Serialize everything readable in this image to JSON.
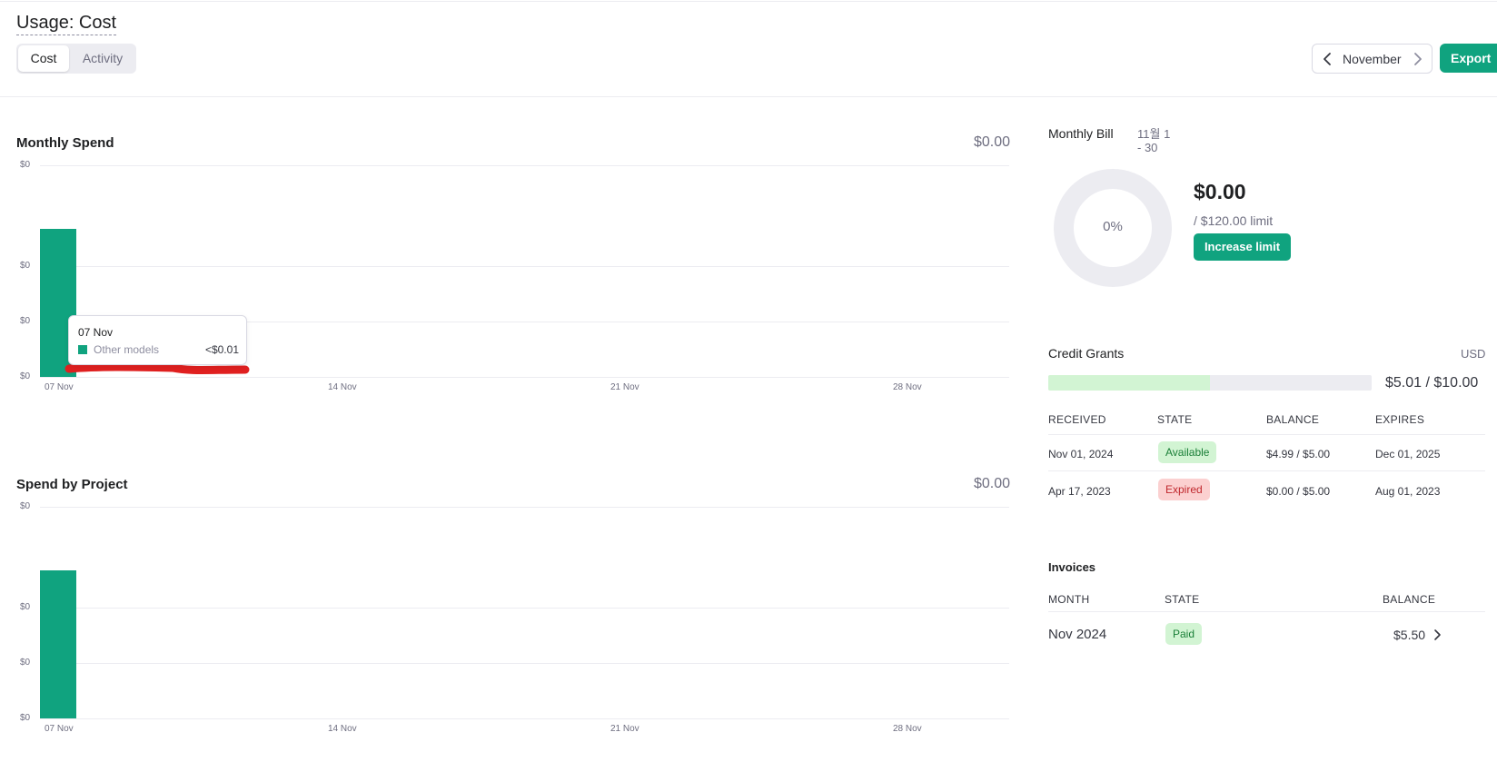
{
  "page": {
    "title": "Usage: Cost"
  },
  "tabs": [
    {
      "label": "Cost",
      "active": true
    },
    {
      "label": "Activity",
      "active": false
    }
  ],
  "month_nav": {
    "label": "November",
    "prev_icon": "chevron-left-icon",
    "next_icon": "chevron-right-icon"
  },
  "export_label": "Export",
  "monthly_spend": {
    "title": "Monthly Spend",
    "total": "$0.00",
    "tooltip": {
      "date": "07 Nov",
      "series": "Other models",
      "value": "<$0.01"
    }
  },
  "spend_by_project": {
    "title": "Spend by Project",
    "total": "$0.00"
  },
  "chart_data": [
    {
      "type": "bar",
      "title": "Monthly Spend",
      "y_tick_labels": [
        "$0",
        "$0",
        "$0",
        "$0"
      ],
      "x_tick_labels": [
        "07 Nov",
        "14 Nov",
        "21 Nov",
        "28 Nov"
      ],
      "categories": [
        "07 Nov"
      ],
      "values": [
        0.007
      ],
      "ylim": [
        0,
        0.01
      ],
      "color": "#10a37f",
      "grid": true
    },
    {
      "type": "bar",
      "title": "Spend by Project",
      "y_tick_labels": [
        "$0",
        "$0",
        "$0",
        "$0"
      ],
      "x_tick_labels": [
        "07 Nov",
        "14 Nov",
        "21 Nov",
        "28 Nov"
      ],
      "categories": [
        "07 Nov"
      ],
      "values": [
        0.007
      ],
      "ylim": [
        0,
        0.01
      ],
      "color": "#10a37f",
      "grid": true
    }
  ],
  "monthly_bill": {
    "title": "Monthly Bill",
    "date_range": "11월 1 - 30",
    "percent_label": "0%",
    "percent_value": 0,
    "amount": "$0.00",
    "limit": "/ $120.00 limit",
    "increase_label": "Increase limit"
  },
  "credit_grants": {
    "title": "Credit Grants",
    "currency": "USD",
    "used_fraction": 0.501,
    "amount": "$5.01 / $10.00",
    "headers": [
      "RECEIVED",
      "STATE",
      "BALANCE",
      "EXPIRES"
    ],
    "rows": [
      {
        "received": "Nov 01, 2024",
        "state": "Available",
        "balance": "$4.99 / $5.00",
        "expires": "Dec 01, 2025"
      },
      {
        "received": "Apr 17, 2023",
        "state": "Expired",
        "balance": "$0.00 / $5.00",
        "expires": "Aug 01, 2023"
      }
    ]
  },
  "invoices": {
    "title": "Invoices",
    "headers": [
      "MONTH",
      "STATE",
      "BALANCE"
    ],
    "rows": [
      {
        "month": "Nov 2024",
        "state": "Paid",
        "balance": "$5.50"
      }
    ]
  },
  "colors": {
    "accent": "#10a37f",
    "grid": "#ececf1",
    "muted": "#6e6e80",
    "annotation": "#e02020"
  }
}
